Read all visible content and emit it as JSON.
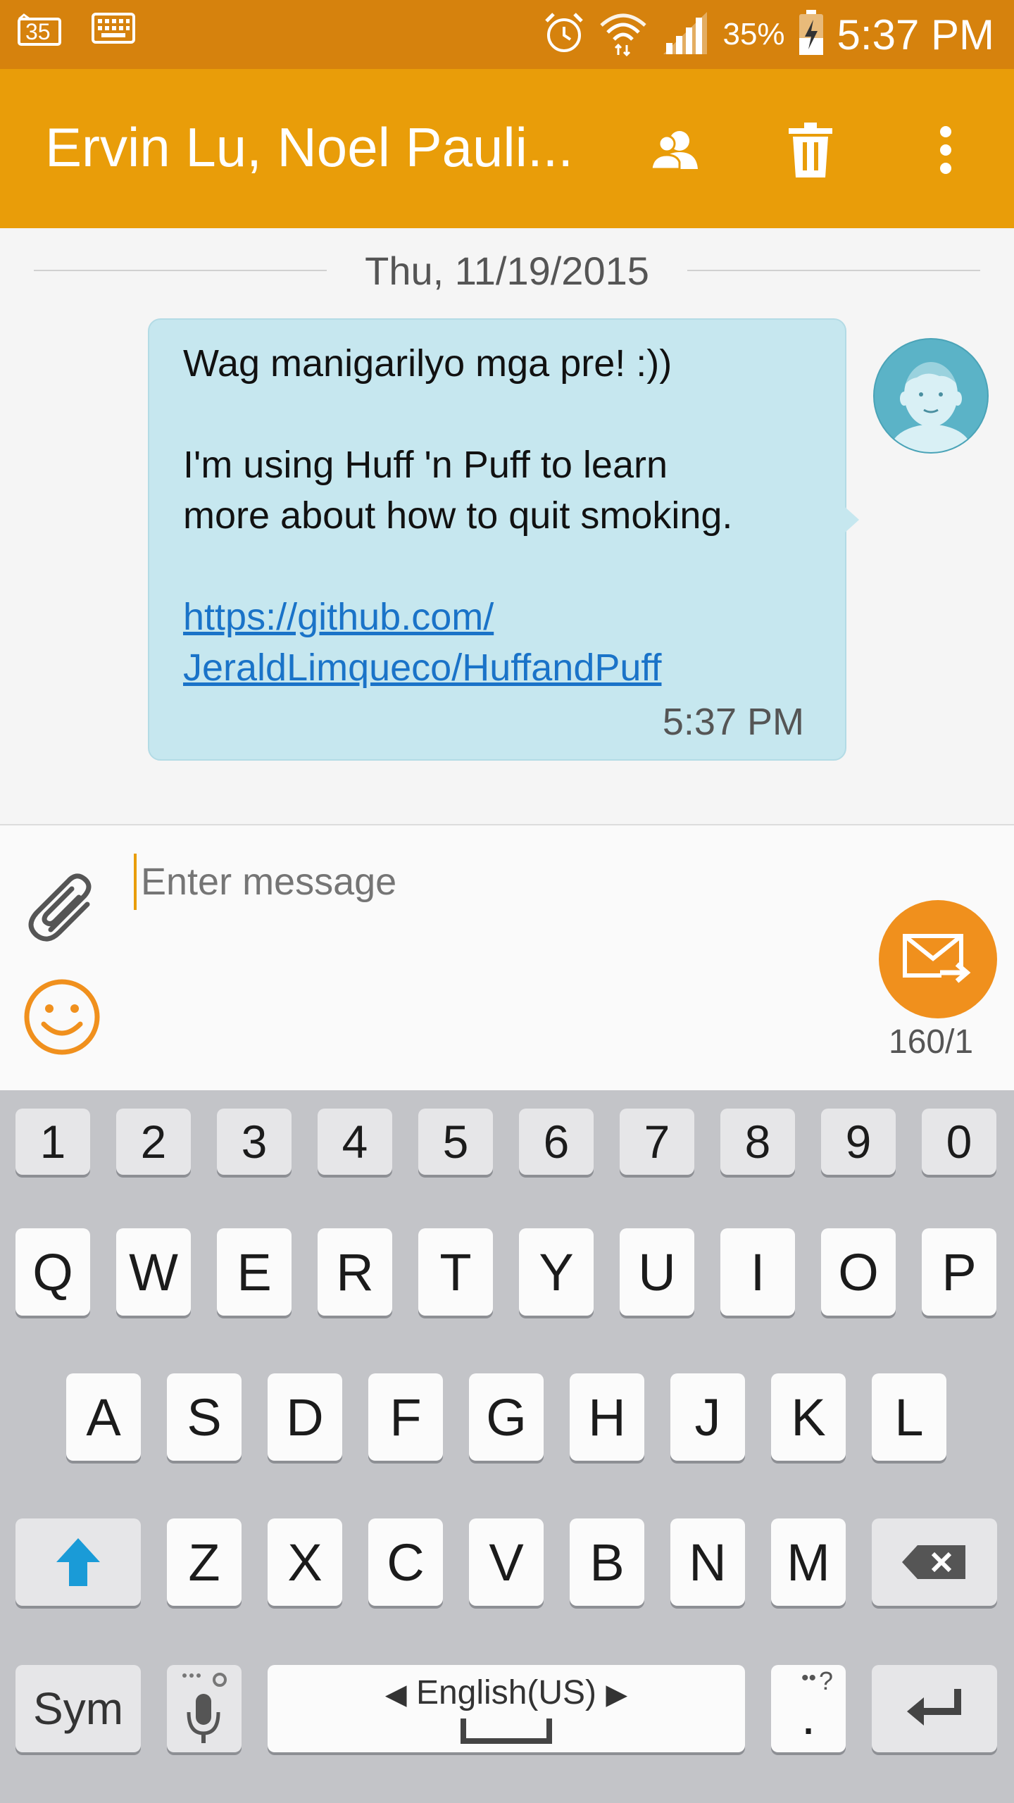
{
  "status_bar": {
    "notification_badge": "35",
    "battery_percent": "35%",
    "time": "5:37 PM",
    "icons": [
      "notification-35-icon",
      "keyboard-icon",
      "alarm-icon",
      "wifi-icon",
      "signal-icon",
      "battery-charging-icon"
    ]
  },
  "action_bar": {
    "title": "Ervin Lu, Noel Pauli...",
    "icons": [
      "contacts-icon",
      "delete-icon",
      "overflow-menu-icon"
    ]
  },
  "conversation": {
    "date": "Thu, 11/19/2015",
    "message": {
      "line1": "Wag manigarilyo mga pre! :))",
      "line2": "I'm using Huff 'n Puff to learn",
      "line3": "more about how to quit smoking.",
      "link_line1": "https://github.com/",
      "link_line2": "JeraldLimqueco/HuffandPuff",
      "time": "5:37 PM"
    }
  },
  "compose": {
    "placeholder": "Enter message",
    "counter": "160/1"
  },
  "keyboard": {
    "numbers": [
      "1",
      "2",
      "3",
      "4",
      "5",
      "6",
      "7",
      "8",
      "9",
      "0"
    ],
    "row1": [
      "Q",
      "W",
      "E",
      "R",
      "T",
      "Y",
      "U",
      "I",
      "O",
      "P"
    ],
    "row2": [
      "A",
      "S",
      "D",
      "F",
      "G",
      "H",
      "J",
      "K",
      "L"
    ],
    "row3": [
      "Z",
      "X",
      "C",
      "V",
      "B",
      "N",
      "M"
    ],
    "sym_label": "Sym",
    "space_label": "English(US)",
    "punct_label": ".",
    "punct_hint": "?"
  },
  "colors": {
    "status_bar": "#d6820d",
    "action_bar": "#e99d09",
    "bubble": "#c6e7ef",
    "send_button": "#f0901d",
    "link": "#1a73c8"
  }
}
